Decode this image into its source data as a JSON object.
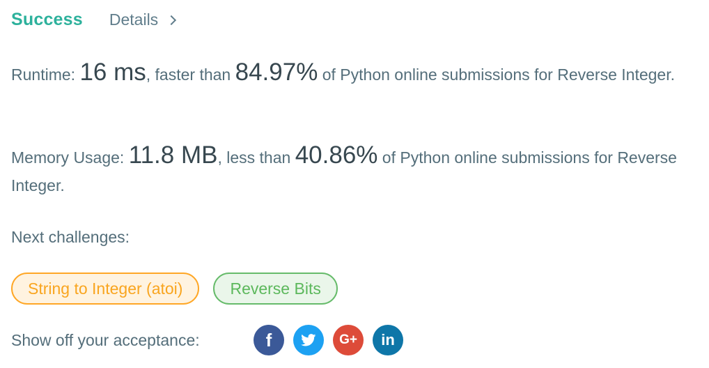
{
  "header": {
    "status": "Success",
    "details_label": "Details"
  },
  "runtime": {
    "label": "Runtime: ",
    "value": "16 ms",
    "comparison": ", faster than ",
    "percent": "84.97%",
    "suffix": " of Python online submissions for Reverse Integer."
  },
  "memory": {
    "label": "Memory Usage: ",
    "value": "11.8 MB",
    "comparison": ", less than ",
    "percent": "40.86%",
    "suffix": " of Python online submissions for Reverse Integer."
  },
  "next": {
    "label": "Next challenges:",
    "challenges": [
      {
        "label": "String to Integer (atoi)",
        "difficulty_color": "#ffa726"
      },
      {
        "label": "Reverse Bits",
        "difficulty_color": "#66bb6a"
      }
    ]
  },
  "share": {
    "label": "Show off your acceptance:",
    "icons": [
      {
        "name": "facebook-icon",
        "glyph": "f",
        "color": "#3b5998"
      },
      {
        "name": "twitter-icon",
        "glyph": "",
        "color": "#1da1f2"
      },
      {
        "name": "google-plus-icon",
        "glyph": "G+",
        "color": "#dd4b39"
      },
      {
        "name": "linkedin-icon",
        "glyph": "in",
        "color": "#0e76a8"
      }
    ]
  },
  "colors": {
    "success": "#2db19c",
    "text": "#546e7a",
    "emphasis": "#37474f"
  }
}
